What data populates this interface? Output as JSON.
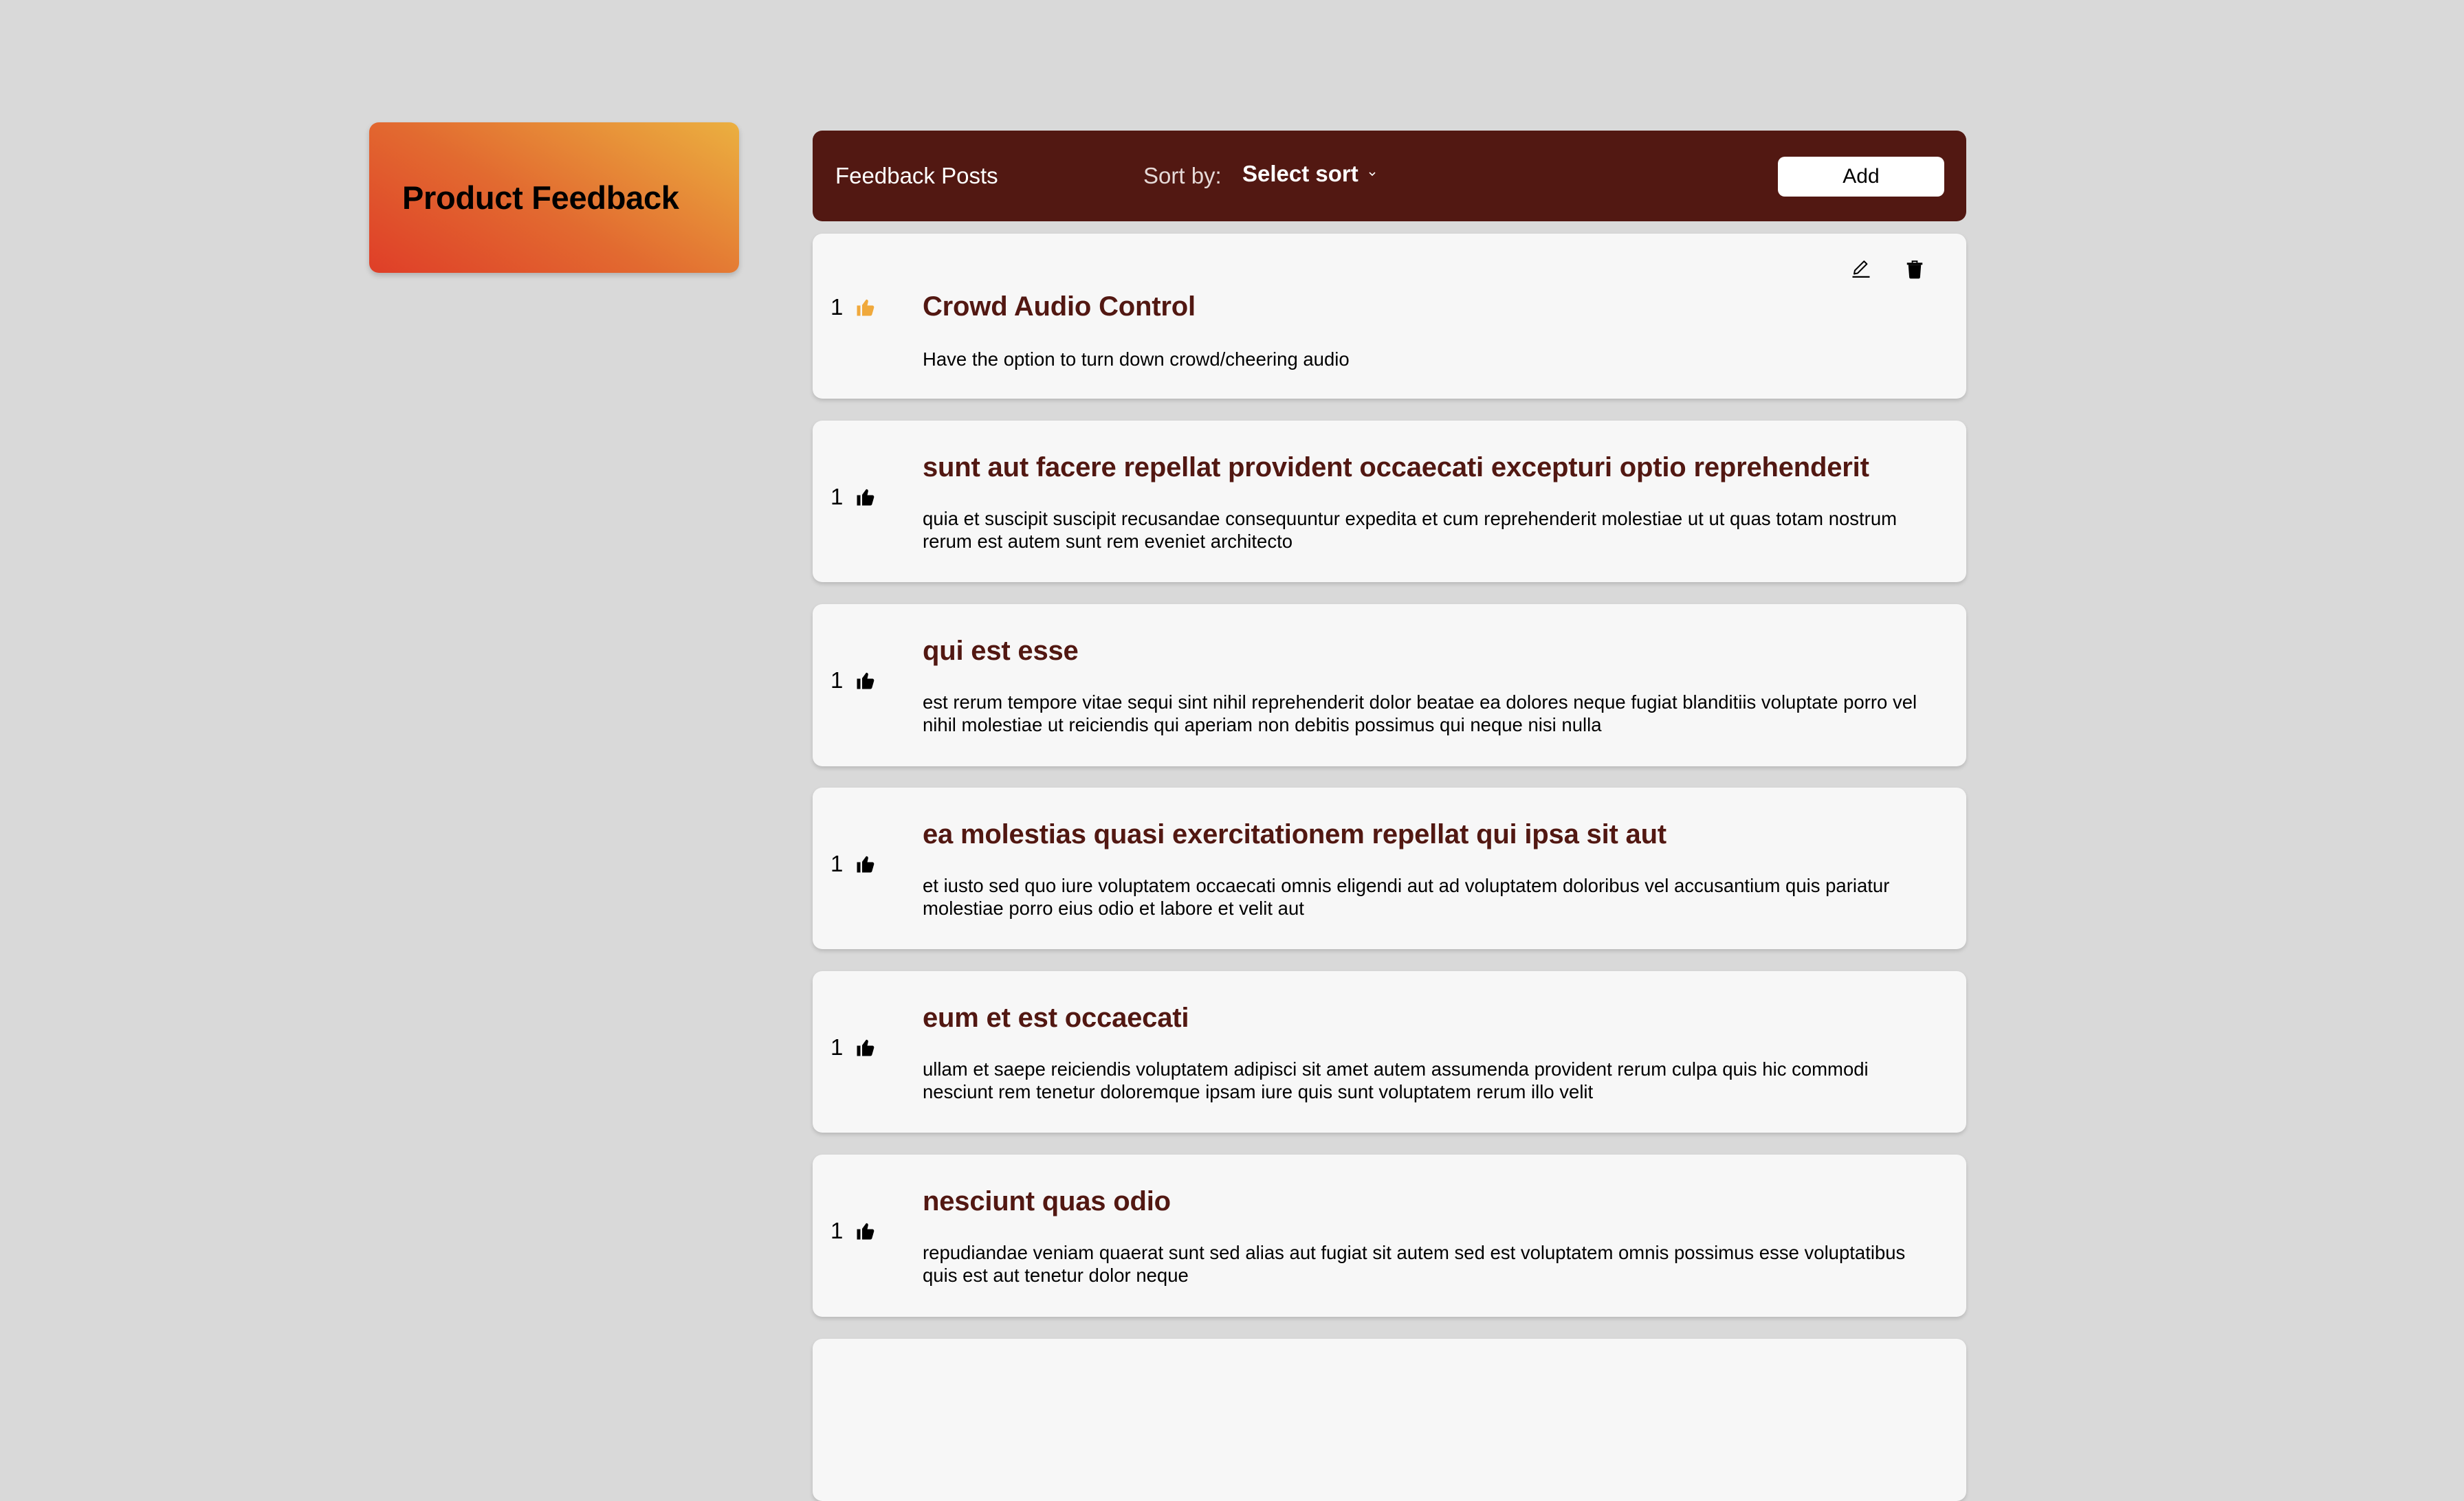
{
  "brand": {
    "title": "Product Feedback"
  },
  "header": {
    "title": "Feedback Posts",
    "sort_label": "Sort by:",
    "sort_value": "Select sort",
    "add_label": "Add"
  },
  "colors": {
    "header_bg": "#521812",
    "title_color": "#521812",
    "upvoted_color": "#f0a93c",
    "page_bg": "#d9d9d9",
    "card_bg": "#f7f7f7"
  },
  "posts": [
    {
      "votes": "1",
      "upvoted": true,
      "title": "Crowd Audio Control",
      "body": "Have the option to turn down crowd/cheering audio",
      "editable": true
    },
    {
      "votes": "1",
      "upvoted": false,
      "title": "sunt aut facere repellat provident occaecati excepturi optio reprehenderit",
      "body": "quia et suscipit suscipit recusandae consequuntur expedita et cum reprehenderit molestiae ut ut quas totam nostrum rerum est autem sunt rem eveniet architecto"
    },
    {
      "votes": "1",
      "upvoted": false,
      "title": "qui est esse",
      "body": "est rerum tempore vitae sequi sint nihil reprehenderit dolor beatae ea dolores neque fugiat blanditiis voluptate porro vel nihil molestiae ut reiciendis qui aperiam non debitis possimus qui neque nisi nulla"
    },
    {
      "votes": "1",
      "upvoted": false,
      "title": "ea molestias quasi exercitationem repellat qui ipsa sit aut",
      "body": "et iusto sed quo iure voluptatem occaecati omnis eligendi aut ad voluptatem doloribus vel accusantium quis pariatur molestiae porro eius odio et labore et velit aut"
    },
    {
      "votes": "1",
      "upvoted": false,
      "title": "eum et est occaecati",
      "body": "ullam et saepe reiciendis voluptatem adipisci sit amet autem assumenda provident rerum culpa quis hic commodi nesciunt rem tenetur doloremque ipsam iure quis sunt voluptatem rerum illo velit"
    },
    {
      "votes": "1",
      "upvoted": false,
      "title": "nesciunt quas odio",
      "body": "repudiandae veniam quaerat sunt sed alias aut fugiat sit autem sed est voluptatem omnis possimus esse voluptatibus quis est aut tenetur dolor neque"
    }
  ]
}
